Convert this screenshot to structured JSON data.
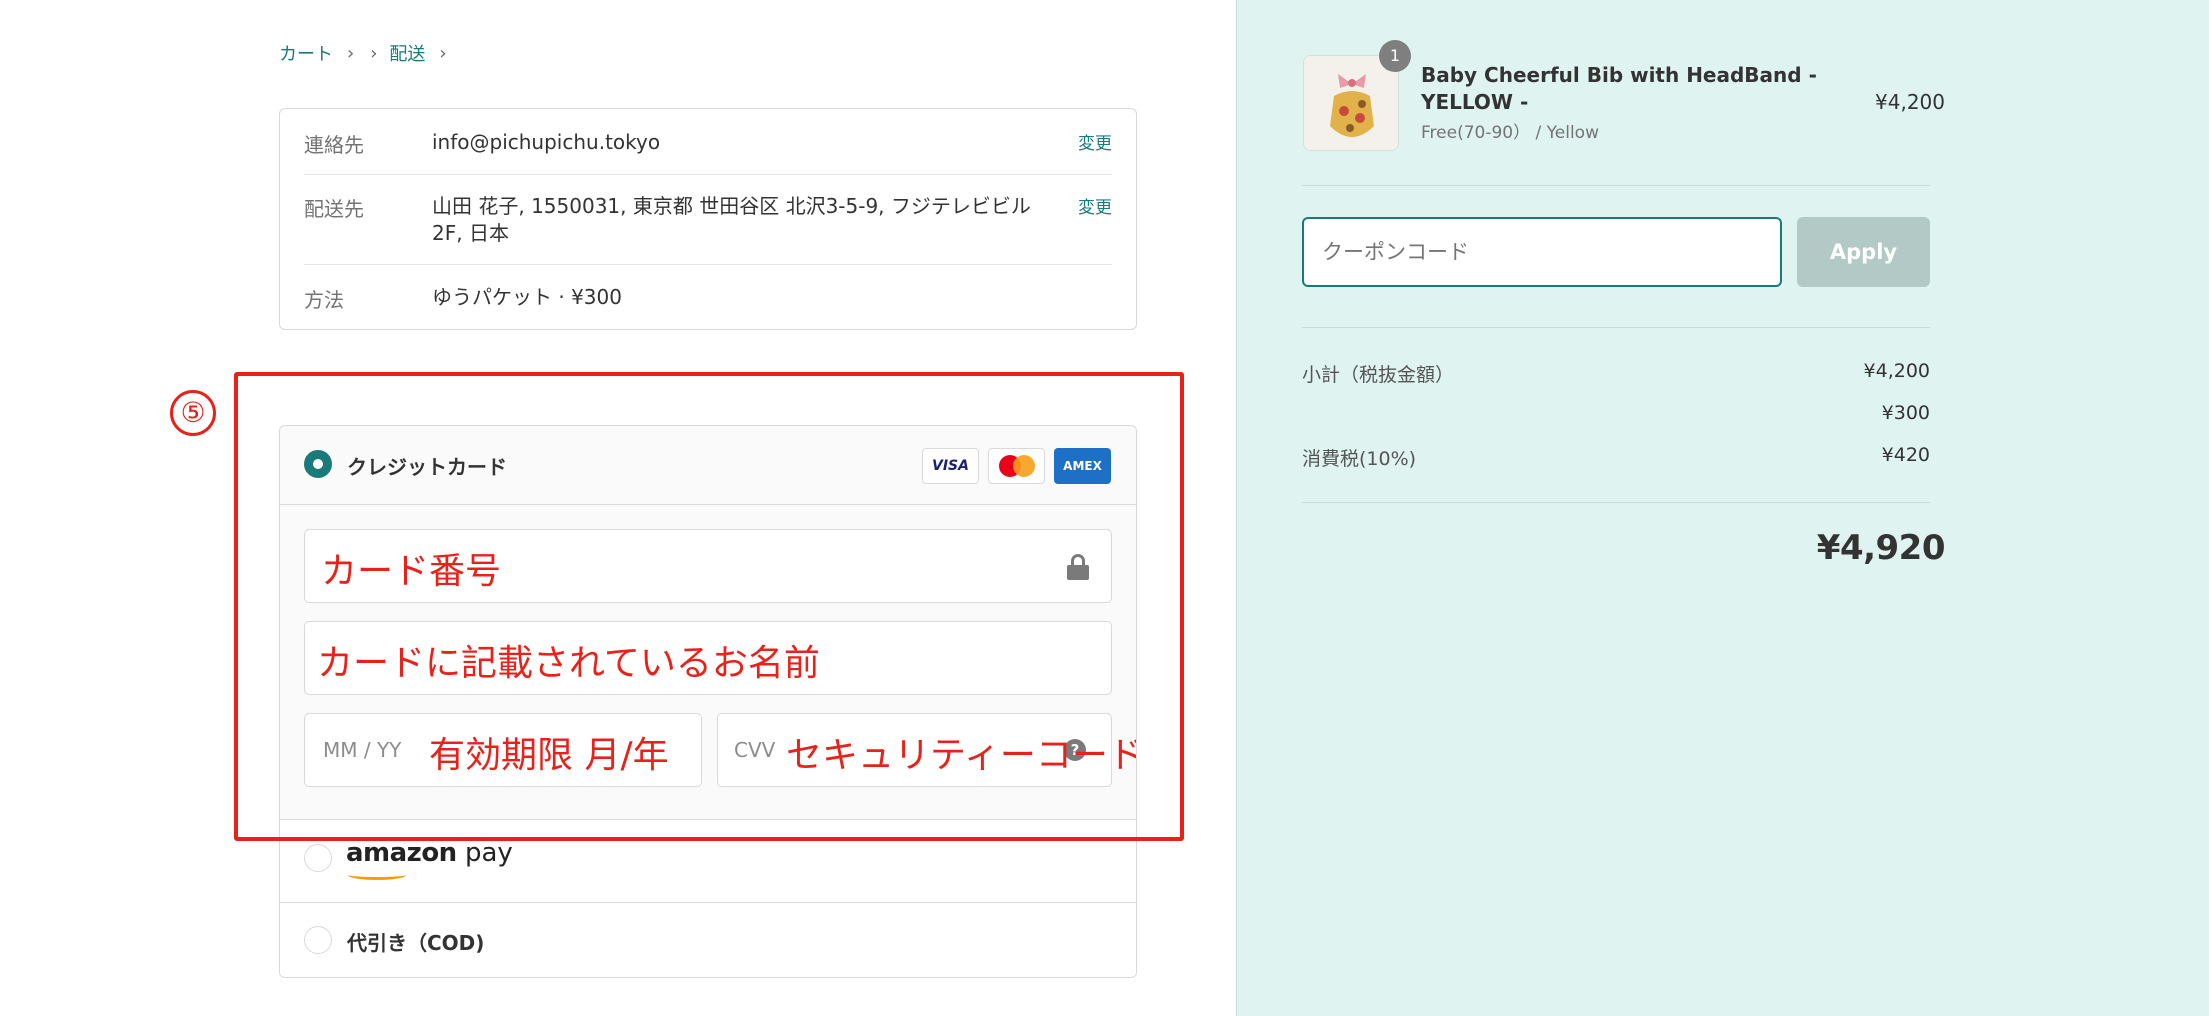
{
  "breadcrumb": {
    "cart": "カート",
    "shipping": "配送"
  },
  "info": {
    "contact_label": "連絡先",
    "contact_value": "info@pichupichu.tokyo",
    "contact_change": "変更",
    "ship_label": "配送先",
    "ship_value": "山田 花子, 1550031, 東京都 世田谷区 北沢3-5-9, フジテレビビル 2F, 日本",
    "ship_change": "変更",
    "method_label": "方法",
    "method_value": "ゆうパケット · ¥300"
  },
  "annotation": {
    "step": "⑤",
    "card_number": "カード番号",
    "card_name": "カードに記載されているお名前",
    "expiry": "有効期限 月/年",
    "security": "セキュリティーコード"
  },
  "payment": {
    "credit_label": "クレジットカード",
    "logos": {
      "visa": "VISA",
      "amex": "AMEX"
    },
    "expiry_placeholder": "MM / YY",
    "cvv_placeholder": "CVV",
    "amazon_bold": "amazon",
    "amazon_pay": " pay",
    "cod_label": "代引き（COD)"
  },
  "order": {
    "qty_badge": "1",
    "product_title": "Baby Cheerful Bib with HeadBand - YELLOW -",
    "product_variant": "Free(70-90） / Yellow",
    "product_price": "¥4,200",
    "coupon_placeholder": "クーポンコード",
    "apply_label": "Apply",
    "subtotal_label": "小計（税抜金額）",
    "subtotal_value": "¥4,200",
    "shipping_value": "¥300",
    "tax_label": "消費税(10%)",
    "tax_value": "¥420",
    "total_value": "¥4,920"
  },
  "colors": {
    "accent": "#1a7a7a",
    "annotation_red": "#e8221b",
    "sidebar_bg": "#dff3f0",
    "apply_disabled": "#b3c9c6"
  }
}
